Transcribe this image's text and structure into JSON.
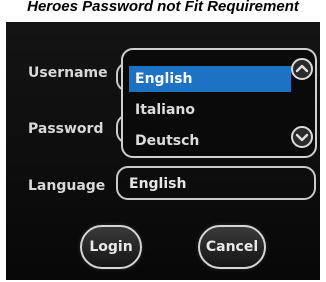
{
  "caption": "Heroes Password not Fit Requirement",
  "form": {
    "username_label": "Username",
    "password_label": "Password",
    "language_label": "Language",
    "language_value": "English"
  },
  "language_dropdown": {
    "options": [
      "English",
      "Italiano",
      "Deutsch"
    ],
    "selected": "English",
    "scroll_up_icon": "chevron-up-icon",
    "scroll_down_icon": "chevron-down-icon",
    "highlight_color": "#1e72c4"
  },
  "buttons": {
    "login_label": "Login",
    "cancel_label": "Cancel"
  }
}
